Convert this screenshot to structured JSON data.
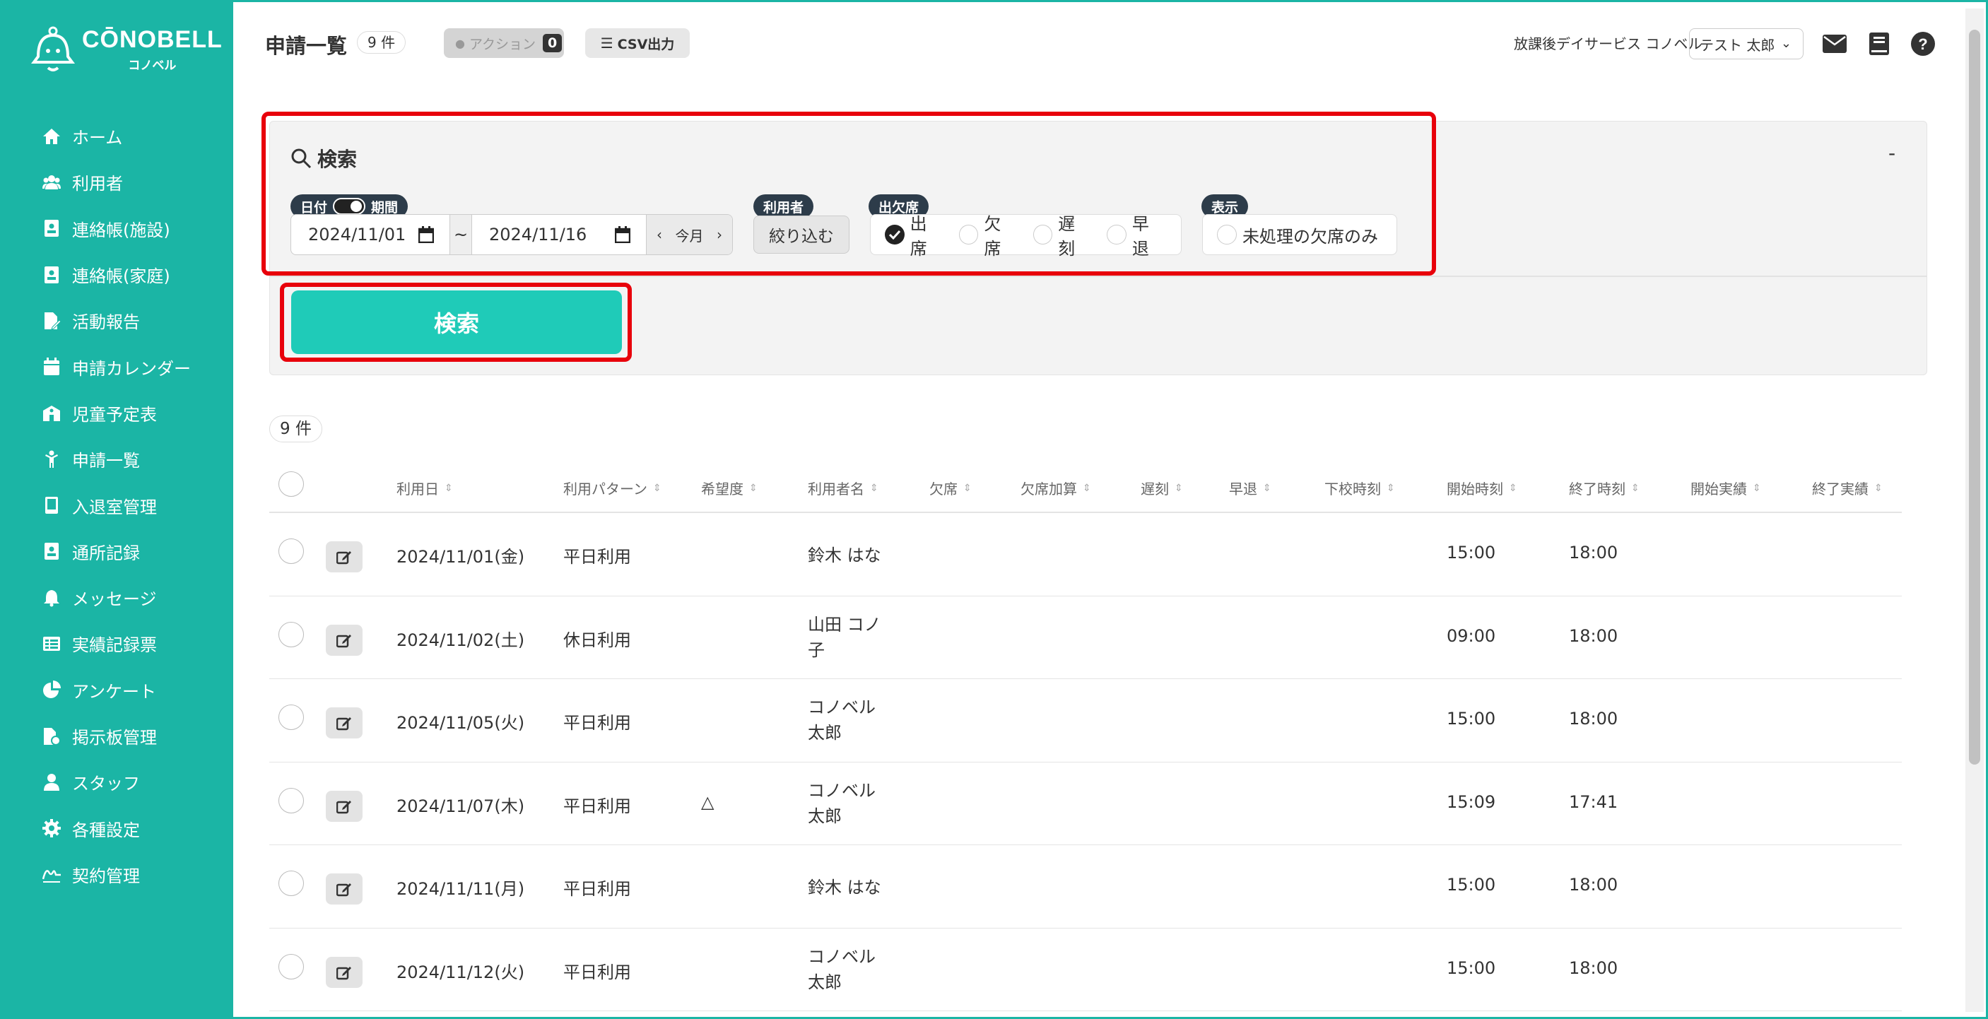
{
  "sidebar": {
    "logo_main": "CŌNOBELL",
    "logo_sub": "コノベル",
    "items": [
      {
        "label": "ホーム",
        "icon": "home-icon"
      },
      {
        "label": "利用者",
        "icon": "users-icon"
      },
      {
        "label": "連絡帳(施設)",
        "icon": "contact-card-icon"
      },
      {
        "label": "連絡帳(家庭)",
        "icon": "contact-card-icon"
      },
      {
        "label": "活動報告",
        "icon": "file-edit-icon"
      },
      {
        "label": "申請カレンダー",
        "icon": "calendar-icon"
      },
      {
        "label": "児童予定表",
        "icon": "school-icon"
      },
      {
        "label": "申請一覧",
        "icon": "child-icon"
      },
      {
        "label": "入退室管理",
        "icon": "tablet-icon"
      },
      {
        "label": "通所記録",
        "icon": "contact-card-icon"
      },
      {
        "label": "メッセージ",
        "icon": "bell-icon"
      },
      {
        "label": "実績記録票",
        "icon": "table-icon"
      },
      {
        "label": "アンケート",
        "icon": "pie-chart-icon"
      },
      {
        "label": "掲示板管理",
        "icon": "file-gear-icon"
      },
      {
        "label": "スタッフ",
        "icon": "staff-icon"
      },
      {
        "label": "各種設定",
        "icon": "gear-icon"
      },
      {
        "label": "契約管理",
        "icon": "signature-icon"
      }
    ]
  },
  "header": {
    "title": "申請一覧",
    "count": "9 件",
    "action_label": "アクション",
    "action_count": "0",
    "csv_label": "CSV出力",
    "facility": "放課後デイサービス コノベル",
    "user": "テスト 太郎"
  },
  "search": {
    "title": "検索",
    "collapse": "-",
    "date_pill_left": "日付",
    "date_pill_right": "期間",
    "date_from": "2024/11/01",
    "date_to": "2024/11/16",
    "tilde": "~",
    "this_month": "今月",
    "user_pill": "利用者",
    "filter_button": "絞り込む",
    "attendance_pill": "出欠席",
    "attendance_options": [
      "出席",
      "欠席",
      "遅刻",
      "早退"
    ],
    "display_pill": "表示",
    "display_option": "未処理の欠席のみ",
    "search_button": "検索"
  },
  "results": {
    "count": "9 件",
    "columns": [
      "利用日",
      "利用パターン",
      "希望度",
      "利用者名",
      "欠席",
      "欠席加算",
      "遅刻",
      "早退",
      "下校時刻",
      "開始時刻",
      "終了時刻",
      "開始実績",
      "終了実績"
    ],
    "rows": [
      {
        "date": "2024/11/01(金)",
        "pattern": "平日利用",
        "hope": "",
        "name": "鈴木 はな",
        "start": "15:00",
        "end": "18:00"
      },
      {
        "date": "2024/11/02(土)",
        "pattern": "休日利用",
        "hope": "",
        "name": "山田 コノ子",
        "start": "09:00",
        "end": "18:00"
      },
      {
        "date": "2024/11/05(火)",
        "pattern": "平日利用",
        "hope": "",
        "name": "コノベル 太郎",
        "start": "15:00",
        "end": "18:00"
      },
      {
        "date": "2024/11/07(木)",
        "pattern": "平日利用",
        "hope": "△",
        "name": "コノベル 太郎",
        "start": "15:09",
        "end": "17:41"
      },
      {
        "date": "2024/11/11(月)",
        "pattern": "平日利用",
        "hope": "",
        "name": "鈴木 はな",
        "start": "15:00",
        "end": "18:00"
      },
      {
        "date": "2024/11/12(火)",
        "pattern": "平日利用",
        "hope": "",
        "name": "コノベル 太郎",
        "start": "15:00",
        "end": "18:00"
      }
    ]
  },
  "colors": {
    "sidebar": "#1bb5a5",
    "search_button": "#1fcbb8",
    "highlight": "#e8000b"
  }
}
